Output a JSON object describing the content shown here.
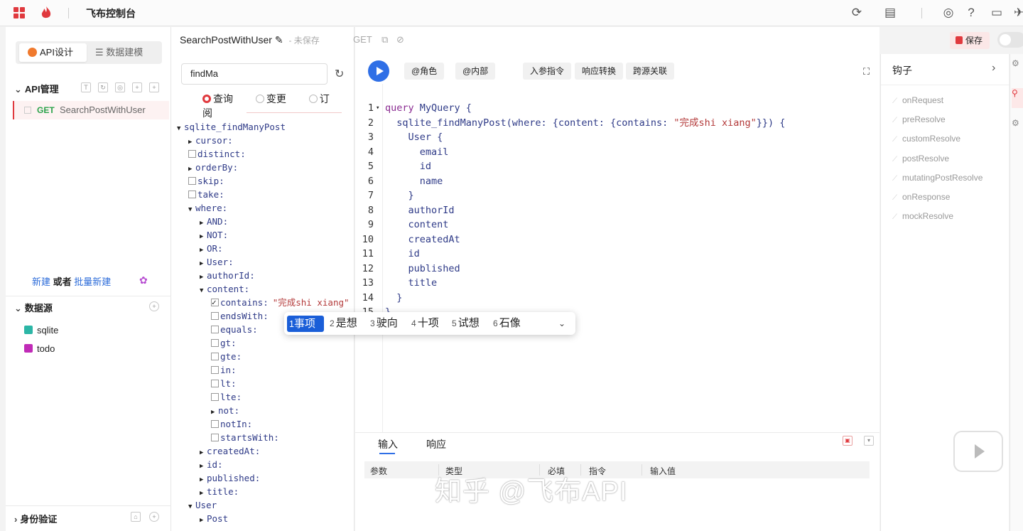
{
  "topbar": {
    "title": "飞布控制台"
  },
  "left": {
    "segment": {
      "active": "API设计",
      "inactive": "数据建模"
    },
    "api_section": "API管理",
    "api_item": {
      "method": "GET",
      "name": "SearchPostWithUser"
    },
    "new_link": {
      "new": "新建",
      "or": "或者",
      "batch": "批量新建"
    },
    "datasource_section": "数据源",
    "datasources": [
      {
        "name": "sqlite",
        "color": "#2cb6a6"
      },
      {
        "name": "todo",
        "color": "#c02bb7"
      }
    ],
    "auth_section": "身份验证"
  },
  "tree_panel": {
    "tab_title": "SearchPostWithUser",
    "unsaved": "- 未保存",
    "search_value": "findMa",
    "radios": [
      "查询",
      "变更",
      "订阅"
    ],
    "tree": [
      {
        "label": "sqlite_findManyPost",
        "kind": "open",
        "indent": 0
      },
      {
        "label": "cursor:",
        "kind": "closed",
        "indent": 1
      },
      {
        "label": "distinct:",
        "kind": "check",
        "indent": 1
      },
      {
        "label": "orderBy:",
        "kind": "closed",
        "indent": 1
      },
      {
        "label": "skip:",
        "kind": "check",
        "indent": 1
      },
      {
        "label": "take:",
        "kind": "check",
        "indent": 1
      },
      {
        "label": "where:",
        "kind": "open",
        "indent": 1
      },
      {
        "label": "AND:",
        "kind": "closed",
        "indent": 2
      },
      {
        "label": "NOT:",
        "kind": "closed",
        "indent": 2
      },
      {
        "label": "OR:",
        "kind": "closed",
        "indent": 2
      },
      {
        "label": "User:",
        "kind": "closed",
        "indent": 2
      },
      {
        "label": "authorId:",
        "kind": "closed",
        "indent": 2
      },
      {
        "label": "content:",
        "kind": "open",
        "indent": 2
      },
      {
        "label": "contains:",
        "kind": "checked",
        "indent": 3,
        "value": "\"完成shi xiang\""
      },
      {
        "label": "endsWith:",
        "kind": "check",
        "indent": 3
      },
      {
        "label": "equals:",
        "kind": "check",
        "indent": 3
      },
      {
        "label": "gt:",
        "kind": "check",
        "indent": 3
      },
      {
        "label": "gte:",
        "kind": "check",
        "indent": 3
      },
      {
        "label": "in:",
        "kind": "check",
        "indent": 3
      },
      {
        "label": "lt:",
        "kind": "check",
        "indent": 3
      },
      {
        "label": "lte:",
        "kind": "check",
        "indent": 3
      },
      {
        "label": "not:",
        "kind": "closed",
        "indent": 3
      },
      {
        "label": "notIn:",
        "kind": "check",
        "indent": 3
      },
      {
        "label": "startsWith:",
        "kind": "check",
        "indent": 3
      },
      {
        "label": "createdAt:",
        "kind": "closed",
        "indent": 2
      },
      {
        "label": "id:",
        "kind": "closed",
        "indent": 2
      },
      {
        "label": "published:",
        "kind": "closed",
        "indent": 2
      },
      {
        "label": "title:",
        "kind": "closed",
        "indent": 2
      },
      {
        "label": "User",
        "kind": "open",
        "indent": 1
      },
      {
        "label": "Post",
        "kind": "closed",
        "indent": 2
      }
    ]
  },
  "editor": {
    "method_tab": "GET",
    "toolbar": [
      "@角色",
      "@内部",
      "入参指令",
      "响应转换",
      "跨源关联"
    ],
    "code": [
      {
        "n": "1",
        "fold": true,
        "tokens": [
          [
            "kw",
            "query "
          ],
          [
            "fn",
            "MyQuery {"
          ]
        ]
      },
      {
        "n": "2",
        "tokens": [
          [
            "fn",
            "  sqlite_findManyPost(where: {content: {contains: "
          ],
          [
            "str",
            "\"完成shi xiang\""
          ],
          [
            "fn",
            "}}) {"
          ]
        ]
      },
      {
        "n": "3",
        "tokens": [
          [
            "fn",
            "    User {"
          ]
        ]
      },
      {
        "n": "4",
        "tokens": [
          [
            "fn",
            "      email"
          ]
        ]
      },
      {
        "n": "5",
        "tokens": [
          [
            "fn",
            "      id"
          ]
        ]
      },
      {
        "n": "6",
        "tokens": [
          [
            "fn",
            "      name"
          ]
        ]
      },
      {
        "n": "7",
        "tokens": [
          [
            "fn",
            "    }"
          ]
        ]
      },
      {
        "n": "8",
        "tokens": [
          [
            "fn",
            "    authorId"
          ]
        ]
      },
      {
        "n": "9",
        "tokens": [
          [
            "fn",
            "    content"
          ]
        ]
      },
      {
        "n": "10",
        "tokens": [
          [
            "fn",
            "    createdAt"
          ]
        ]
      },
      {
        "n": "11",
        "tokens": [
          [
            "fn",
            "    id"
          ]
        ]
      },
      {
        "n": "12",
        "tokens": [
          [
            "fn",
            "    published"
          ]
        ]
      },
      {
        "n": "13",
        "tokens": [
          [
            "fn",
            "    title"
          ]
        ]
      },
      {
        "n": "14",
        "tokens": [
          [
            "fn",
            "  }"
          ]
        ]
      },
      {
        "n": "15",
        "tokens": [
          [
            "fn",
            "}"
          ]
        ]
      }
    ],
    "ime": {
      "candidates": [
        {
          "num": "1",
          "word": "事项"
        },
        {
          "num": "2",
          "word": "是想"
        },
        {
          "num": "3",
          "word": "驶向"
        },
        {
          "num": "4",
          "word": "十项"
        },
        {
          "num": "5",
          "word": "试想"
        },
        {
          "num": "6",
          "word": "石像"
        }
      ]
    }
  },
  "bottom": {
    "tabs": [
      "输入",
      "响应"
    ],
    "columns": [
      "参数",
      "类型",
      "必填",
      "指令",
      "输入值"
    ]
  },
  "header_right": {
    "save": "保存"
  },
  "hooks": {
    "title": "钩子",
    "items": [
      "onRequest",
      "preResolve",
      "customResolve",
      "postResolve",
      "mutatingPostResolve",
      "onResponse",
      "mockResolve"
    ]
  },
  "watermark": "知乎 @飞布API",
  "colors": {
    "accent": "#e0393e",
    "primary": "#2f6fe6"
  }
}
